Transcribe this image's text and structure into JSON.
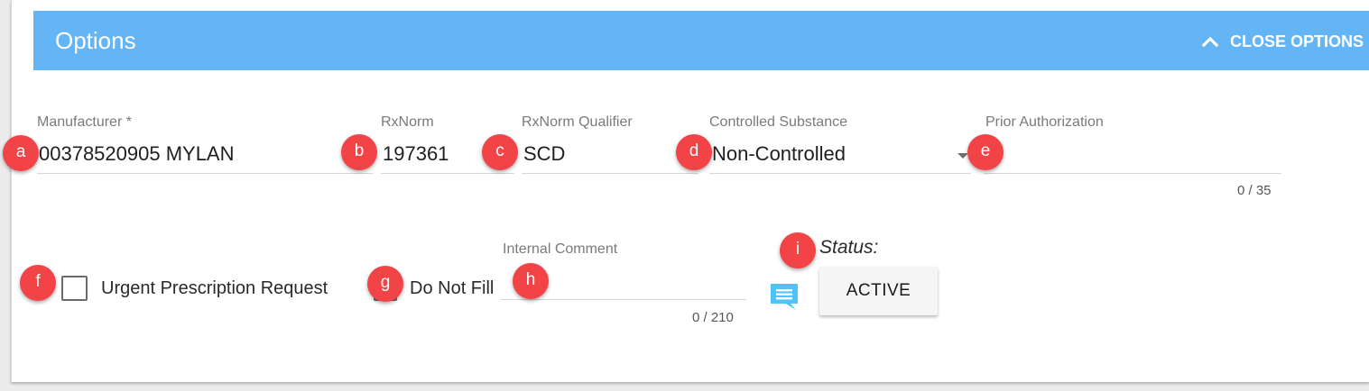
{
  "header": {
    "title": "Options",
    "close_label": "CLOSE OPTIONS",
    "background_color": "#64b5f6"
  },
  "fields": {
    "manufacturer": {
      "label": "Manufacturer *",
      "value": "00378520905 MYLAN"
    },
    "rxnorm": {
      "label": "RxNorm",
      "value": "197361"
    },
    "rxnorm_qualifier": {
      "label": "RxNorm Qualifier",
      "value": "SCD"
    },
    "controlled_substance": {
      "label": "Controlled Substance",
      "value": "Non-Controlled"
    },
    "prior_authorization": {
      "label": "Prior Authorization",
      "value": "",
      "counter": "0 / 35"
    },
    "internal_comment": {
      "label": "Internal Comment",
      "value": "",
      "counter": "0 / 210"
    }
  },
  "checkboxes": {
    "urgent": {
      "label": "Urgent Prescription Request",
      "checked": false
    },
    "do_not_fill": {
      "label": "Do Not Fill",
      "checked": false
    }
  },
  "status": {
    "label": "Status:",
    "button_label": "ACTIVE"
  },
  "annotations": {
    "a": "a",
    "b": "b",
    "c": "c",
    "d": "d",
    "e": "e",
    "f": "f",
    "g": "g",
    "h": "h",
    "i": "i",
    "color": "#f24346"
  },
  "icons": {
    "close_chevron": "chevron-up-icon",
    "comment": "comment-icon",
    "dropdown": "dropdown-arrow-icon"
  }
}
